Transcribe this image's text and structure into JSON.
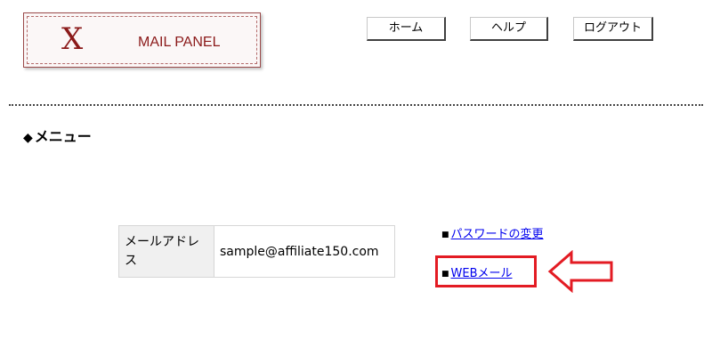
{
  "logo": {
    "mark": "X",
    "text": "MAIL PANEL"
  },
  "nav": {
    "home": "ホーム",
    "help": "ヘルプ",
    "logout": "ログアウト"
  },
  "menu": {
    "diamond": "◆",
    "title": "メニュー"
  },
  "account": {
    "label": "メールアドレス",
    "value": "sample@affiliate150.com"
  },
  "links": {
    "bullet": "■",
    "password_change": "パスワードの変更",
    "webmail": "WEBメール"
  },
  "annotation": {
    "highlight_color": "#e31b23",
    "arrow_color": "#e31b23",
    "arrow_direction": "left"
  }
}
